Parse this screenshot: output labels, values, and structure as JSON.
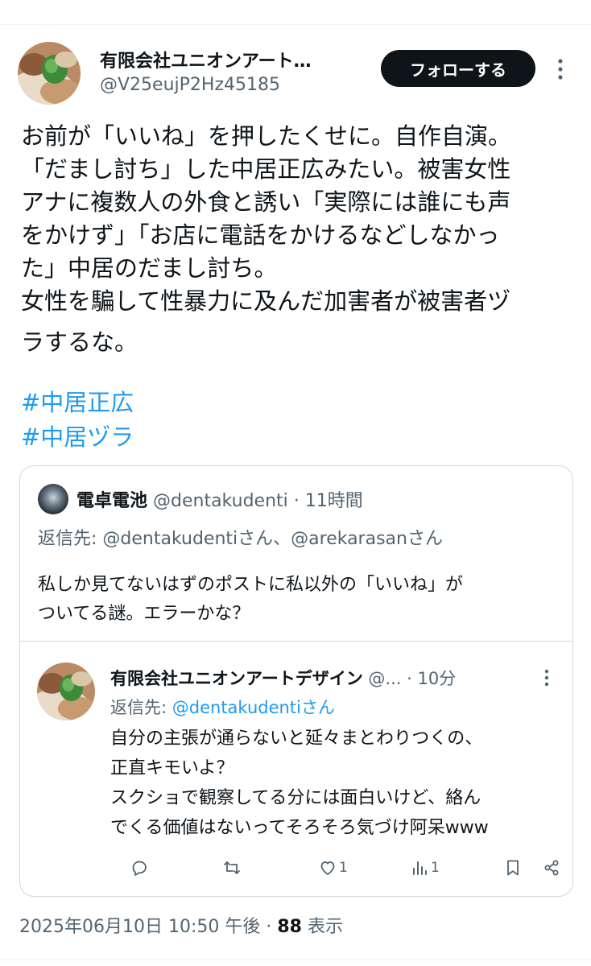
{
  "tweet": {
    "author_name": "有限会社ユニオンアート…",
    "author_handle": "@V25eujP2Hz45185",
    "follow_label": "フォローする",
    "text_lines": [
      "お前が「いいね」を押したくせに。自作自演。",
      "「だまし討ち」した中居正広みたい。被害女性",
      "アナに複数人の外食と誘い「実際には誰にも声",
      "をかけず」「お店に電話をかけるなどしなかっ",
      "た」中居のだまし討ち。",
      "女性を騙して性暴力に及んだ加害者が被害者ヅ",
      "ラするな。"
    ],
    "hashtags": [
      "#中居正広",
      "#中居ヅラ"
    ],
    "timestamp": "2025年06月10日 10:50 午後 · ",
    "views_count": "88",
    "views_label": " 表示"
  },
  "quote": {
    "author_name": "電卓電池",
    "meta": " @dentakudenti · 11時間",
    "reply_to": "返信先: @dentakudentiさん、@arekarasanさん",
    "text_lines": [
      "私しか見てないはずのポストに私以外の「いいね」が",
      "ついてる謎。エラーかな？"
    ]
  },
  "nested_reply": {
    "author_name": "有限会社ユニオンアートデザイン",
    "meta": " @... · 10分",
    "reply_prefix": "返信先: ",
    "reply_link": "@dentakudentiさん",
    "text_lines": [
      "自分の主張が通らないと延々まとわりつくの、",
      "正直キモいよ？",
      "スクショで観察してる分には面白いけど、絡ん",
      "でくる価値はないってそろそろ気づけ阿呆www"
    ],
    "actions": {
      "like_count": "1",
      "views_count": "1"
    }
  }
}
